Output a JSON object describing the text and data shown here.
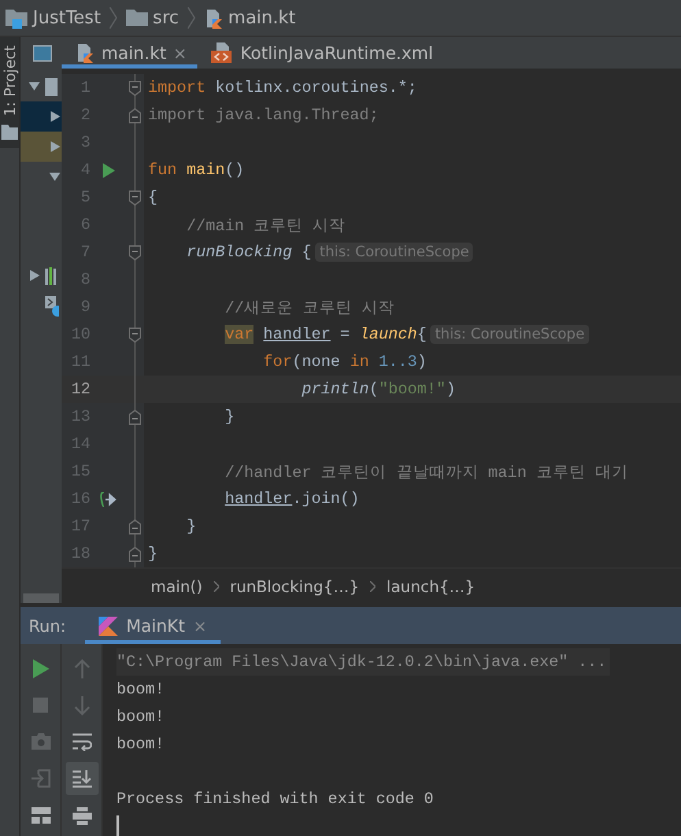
{
  "nav_bar": {
    "breadcrumbs": [
      {
        "label": "JustTest",
        "kind": "project"
      },
      {
        "label": "src",
        "kind": "folder"
      },
      {
        "label": "main.kt",
        "kind": "kotlin"
      }
    ]
  },
  "side_stripe": {
    "tabs": [
      {
        "label": "1: Project",
        "selected": true
      }
    ]
  },
  "project_tree": {
    "rows": [
      {
        "kind": "module",
        "expanded": true,
        "selected": false,
        "highlighted": false,
        "children": [
          {
            "expanded": false,
            "selected": true,
            "highlighted": false
          },
          {
            "expanded": false,
            "selected": false,
            "highlighted": true
          },
          {
            "expanded": true,
            "selected": false,
            "highlighted": false
          }
        ]
      },
      {
        "kind": "library",
        "expanded": false,
        "selected": false,
        "highlighted": false
      },
      {
        "kind": "scratch",
        "selected": false,
        "highlighted": false
      }
    ]
  },
  "editor_tabs": [
    {
      "label": "main.kt",
      "kind": "kotlin",
      "selected": true,
      "close": "×"
    },
    {
      "label": "KotlinJavaRuntime.xml",
      "kind": "xml",
      "selected": false
    }
  ],
  "code_lines": [
    {
      "number": "1",
      "kind": "fold-start",
      "current": false,
      "tokens": [
        {
          "kind": "kw",
          "text": "import"
        },
        {
          "kind": "plain",
          "text": " kotlinx.coroutines.*;"
        }
      ]
    },
    {
      "number": "2",
      "kind": "fold-end",
      "current": false,
      "tokens": [
        {
          "kind": "unused",
          "text": "import java.lang.Thread;"
        }
      ]
    },
    {
      "number": "3",
      "kind": "plain",
      "current": false
    },
    {
      "number": "4",
      "kind": "run",
      "current": false,
      "tokens": [
        {
          "kind": "kw",
          "text": "fun"
        },
        {
          "kind": "fn",
          "text": " main"
        },
        {
          "kind": "plain",
          "text": "()"
        }
      ]
    },
    {
      "number": "5",
      "kind": "fold-start",
      "current": false,
      "tokens": [
        {
          "kind": "plain",
          "text": "{"
        }
      ]
    },
    {
      "number": "6",
      "kind": "plain",
      "current": false,
      "tokens": [
        {
          "kind": "comment",
          "text": "    //main 코루틴 시작"
        }
      ]
    },
    {
      "number": "7",
      "kind": "fold-start",
      "current": false,
      "tokens": [
        {
          "kind": "call",
          "text": "    runBlocking"
        },
        {
          "kind": "plain",
          "text": " {"
        },
        {
          "kind": "hint",
          "text": "this: CoroutineScope"
        }
      ]
    },
    {
      "number": "8",
      "kind": "plain",
      "current": false
    },
    {
      "number": "9",
      "kind": "plain",
      "current": false,
      "tokens": [
        {
          "kind": "comment",
          "text": "        //새로운 코루틴 시작"
        }
      ]
    },
    {
      "number": "10",
      "kind": "fold-start",
      "current": false,
      "tokens": [
        {
          "kind": "kw-mark",
          "text": "        var"
        },
        {
          "kind": "ref",
          "text": " handler"
        },
        {
          "kind": "plain",
          "text": " = "
        },
        {
          "kind": "call-ext",
          "text": "launch"
        },
        {
          "kind": "plain",
          "text": "{"
        },
        {
          "kind": "hint",
          "text": "this: CoroutineScope"
        }
      ]
    },
    {
      "number": "11",
      "kind": "plain",
      "current": false,
      "tokens": [
        {
          "kind": "kw",
          "text": "            for"
        },
        {
          "kind": "plain",
          "text": "(none "
        },
        {
          "kind": "kw",
          "text": "in"
        },
        {
          "kind": "number",
          "text": " 1..3"
        },
        {
          "kind": "plain",
          "text": ")"
        }
      ]
    },
    {
      "number": "12",
      "kind": "plain",
      "current": true,
      "tokens": [
        {
          "kind": "call",
          "text": "                println"
        },
        {
          "kind": "plain",
          "text": "("
        },
        {
          "kind": "string",
          "text": "\"boom!\""
        },
        {
          "kind": "plain",
          "text": ")"
        }
      ]
    },
    {
      "number": "13",
      "kind": "fold-end",
      "current": false,
      "tokens": [
        {
          "kind": "plain",
          "text": "        }"
        }
      ]
    },
    {
      "number": "14",
      "kind": "plain",
      "current": false
    },
    {
      "number": "15",
      "kind": "plain",
      "current": false,
      "tokens": [
        {
          "kind": "comment",
          "text": "        //handler 코루틴이 끝날때까지 main 코루틴 대기"
        }
      ]
    },
    {
      "number": "16",
      "kind": "suspend",
      "current": false,
      "tokens": [
        {
          "kind": "ref",
          "text": "        handler"
        },
        {
          "kind": "plain",
          "text": ".join()"
        }
      ]
    },
    {
      "number": "17",
      "kind": "fold-end",
      "current": false,
      "tokens": [
        {
          "kind": "plain",
          "text": "    }"
        }
      ]
    },
    {
      "number": "18",
      "kind": "fold-end",
      "current": false,
      "tokens": [
        {
          "kind": "plain",
          "text": "}"
        }
      ]
    }
  ],
  "code_breadcrumbs": [
    "main()",
    "runBlocking{…}",
    "launch{…}"
  ],
  "run_panel": {
    "title": "Run:",
    "tabs": [
      {
        "label": "MainKt",
        "selected": true,
        "close": "×"
      }
    ],
    "left_toolbar": [
      {
        "kind": "run",
        "disabled": false
      },
      {
        "kind": "stop",
        "disabled": true
      },
      {
        "kind": "camera",
        "disabled": true
      },
      {
        "kind": "exit",
        "disabled": true
      },
      {
        "kind": "layout",
        "disabled": false
      }
    ],
    "right_toolbar": [
      {
        "kind": "up",
        "disabled": true,
        "on": false
      },
      {
        "kind": "down",
        "disabled": true,
        "on": false
      },
      {
        "kind": "wrap",
        "disabled": false,
        "on": false
      },
      {
        "kind": "scroll-end",
        "disabled": false,
        "on": true
      },
      {
        "kind": "print",
        "disabled": false,
        "on": false
      }
    ],
    "console": [
      {
        "kind": "command",
        "text": "\"C:\\Program Files\\Java\\jdk-12.0.2\\bin\\java.exe\" ..."
      },
      {
        "kind": "output",
        "text": "boom!"
      },
      {
        "kind": "output",
        "text": "boom!"
      },
      {
        "kind": "output",
        "text": "boom!"
      },
      {
        "kind": "status",
        "text": "Process finished with exit code 0"
      }
    ]
  }
}
